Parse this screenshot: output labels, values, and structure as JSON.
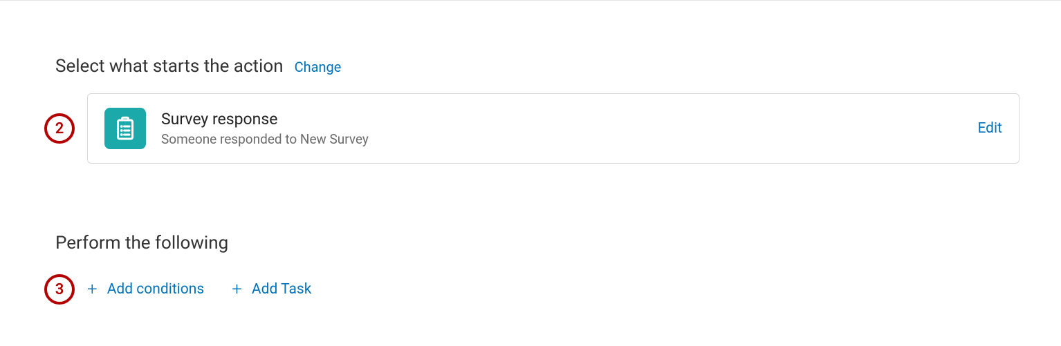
{
  "trigger": {
    "sectionHeading": "Select what starts the action",
    "changeLabel": "Change",
    "stepNumber": "2",
    "title": "Survey response",
    "subtitle": "Someone responded to New Survey",
    "editLabel": "Edit"
  },
  "perform": {
    "heading": "Perform the following",
    "stepNumber": "3",
    "addConditionsLabel": "Add conditions",
    "addTaskLabel": "Add Task"
  }
}
